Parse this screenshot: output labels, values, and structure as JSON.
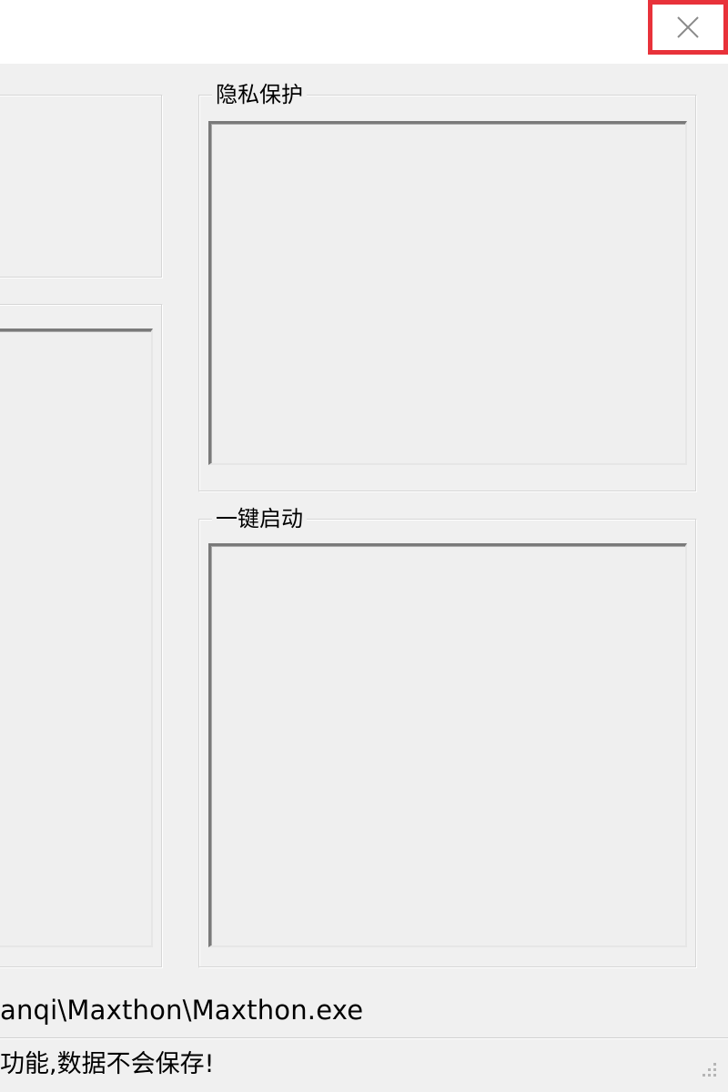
{
  "titlebar": {
    "close_icon": "close-icon"
  },
  "groups": {
    "privacy": {
      "title": "隐私保护"
    },
    "quick_start": {
      "title": "一键启动"
    }
  },
  "status": {
    "path_text": "anqi\\Maxthon\\Maxthon.exe",
    "message": "功能,数据不会保存!"
  },
  "colors": {
    "close_highlight": "#e8323a",
    "window_bg": "#f0f0f0",
    "titlebar_bg": "#ffffff"
  }
}
